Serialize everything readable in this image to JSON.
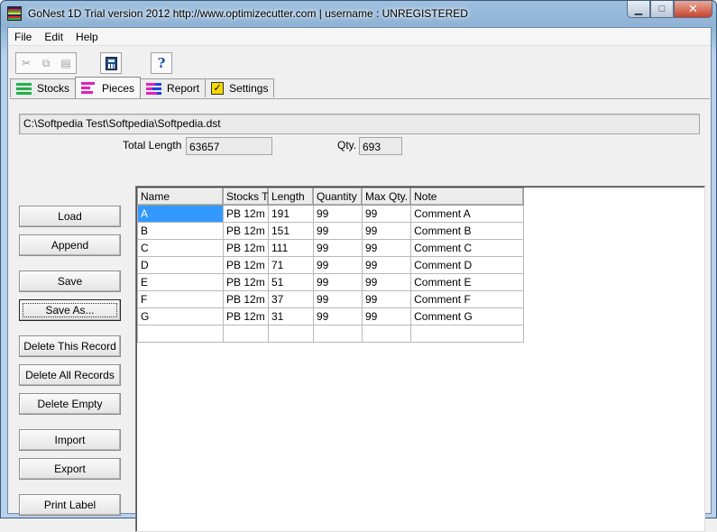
{
  "window": {
    "title": "GoNest 1D Trial version  2012  http://www.optimizecutter.com | username : UNREGISTERED",
    "minimize_glyph": "▁",
    "maximize_glyph": "□",
    "close_glyph": "✕"
  },
  "menu": {
    "items": [
      "File",
      "Edit",
      "Help"
    ]
  },
  "toolbar": {
    "cut_glyph": "✂",
    "copy_glyph": "⧉",
    "paste_glyph": "▤",
    "help_glyph": "?"
  },
  "tabs": [
    {
      "label": "Stocks",
      "icon": "stocks-icon",
      "colors": [
        "#22b14c",
        "#22b14c",
        "#22b14c"
      ]
    },
    {
      "label": "Pieces",
      "icon": "pieces-icon",
      "colors": [
        "#e020c0",
        "#e020c0",
        "#e020c0"
      ]
    },
    {
      "label": "Report",
      "icon": "report-icon",
      "colors": [
        "#e020c0",
        "#e020c0",
        "#e020c0"
      ]
    },
    {
      "label": "Settings",
      "icon": "settings-icon",
      "colors": [
        "#e8c800"
      ]
    }
  ],
  "selected_tab": "Pieces",
  "file_path": "C:\\Softpedia Test\\Softpedia\\Softpedia.dst",
  "summary": {
    "total_length_label": "Total Length",
    "total_length_value": "63657",
    "qty_label": "Qty.",
    "qty_value": "693"
  },
  "buttons": {
    "load": "Load",
    "append": "Append",
    "save": "Save",
    "save_as": "Save As...",
    "delete_record": "Delete This Record",
    "delete_all": "Delete All Records",
    "delete_empty": "Delete Empty",
    "import": "Import",
    "export": "Export",
    "print_label": "Print Label"
  },
  "grid": {
    "columns": [
      "Name",
      "Stocks T",
      "Length",
      "Quantity",
      "Max Qty.",
      "Note"
    ],
    "rows": [
      [
        "A",
        "PB  12m",
        "191",
        "99",
        "99",
        "Comment A"
      ],
      [
        "B",
        "PB  12m",
        "151",
        "99",
        "99",
        "Comment B"
      ],
      [
        "C",
        "PB  12m",
        "111",
        "99",
        "99",
        "Comment C"
      ],
      [
        "D",
        "PB  12m",
        "71",
        "99",
        "99",
        "Comment D"
      ],
      [
        "E",
        "PB  12m",
        "51",
        "99",
        "99",
        "Comment E"
      ],
      [
        "F",
        "PB  12m",
        "37",
        "99",
        "99",
        "Comment F"
      ],
      [
        "G",
        "PB  12m",
        "31",
        "99",
        "99",
        "Comment G"
      ],
      [
        "",
        "",
        "",
        "",
        "",
        ""
      ]
    ],
    "selected_cell": "A",
    "selection_color": "#3399ff"
  }
}
